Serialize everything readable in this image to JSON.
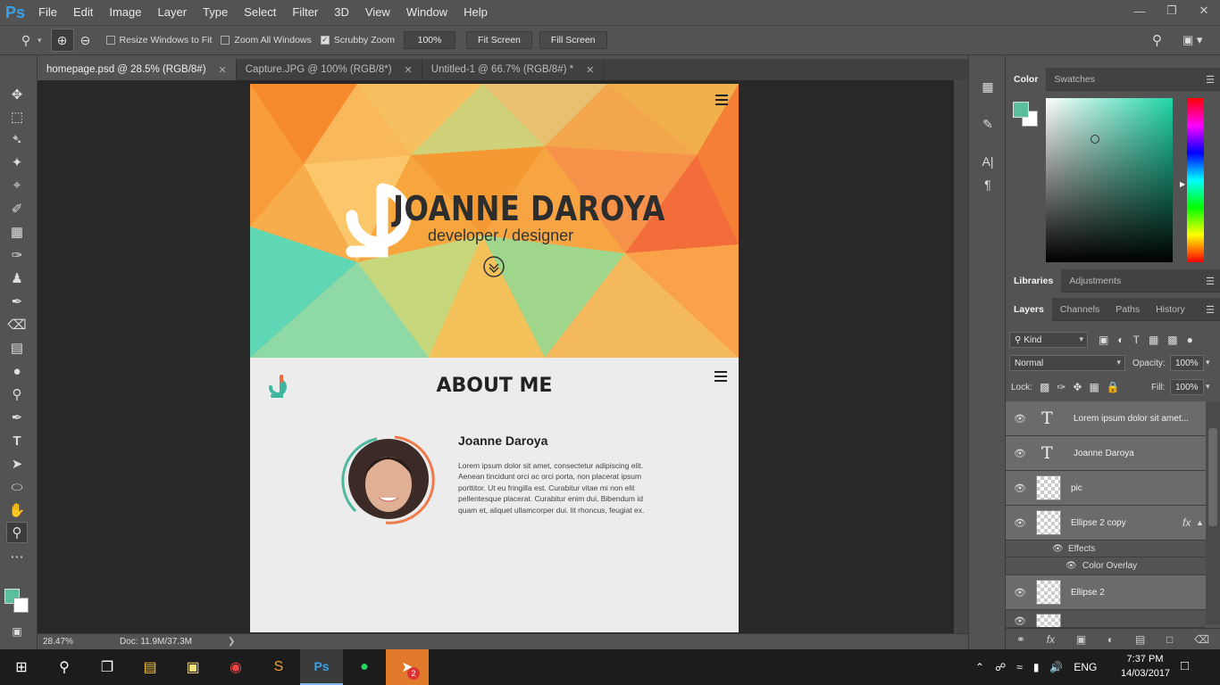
{
  "app": {
    "logo": "Ps",
    "menu": [
      "File",
      "Edit",
      "Image",
      "Layer",
      "Type",
      "Select",
      "Filter",
      "3D",
      "View",
      "Window",
      "Help"
    ],
    "window_controls": [
      "minimize-icon",
      "restore-icon",
      "close-icon"
    ]
  },
  "options": {
    "resize_windows": "Resize Windows to Fit",
    "zoom_all": "Zoom All Windows",
    "scrubby": "Scrubby Zoom",
    "zoom_value": "100%",
    "fit_screen": "Fit Screen",
    "fill_screen": "Fill Screen"
  },
  "tabs": [
    {
      "label": "homepage.psd @ 28.5% (RGB/8#)",
      "active": true
    },
    {
      "label": "Capture.JPG @ 100% (RGB/8*)",
      "active": false
    },
    {
      "label": "Untitled-1 @ 66.7% (RGB/8#) *",
      "active": false
    }
  ],
  "document": {
    "hero_name": "JOANNE DAROYA",
    "hero_sub": "developer / designer",
    "about_title": "ABOUT ME",
    "person_name": "Joanne Daroya",
    "bio": "Lorem ipsum dolor sit amet, consectetur adipiscing elit. Aenean tincidunt orci ac orci porta, non placerat ipsum porttitor. Ut eu fringilla est. Curabitur vitae mi non elit pellentesque placerat. Curabitur enim dui, Bibendum id quam et, aliquet ullamcorper dui. lit rhoncus, feugiat ex."
  },
  "status": {
    "zoom": "28.47%",
    "doc_info": "Doc: 11.9M/37.3M"
  },
  "color_panel": {
    "tabs": [
      "Color",
      "Swatches"
    ],
    "foreground": "#5bbf9f",
    "background": "#ffffff"
  },
  "libraries_panel": {
    "tabs": [
      "Libraries",
      "Adjustments"
    ]
  },
  "layers_panel": {
    "tabs": [
      "Layers",
      "Channels",
      "Paths",
      "History"
    ],
    "kind": "Kind",
    "blend_mode": "Normal",
    "opacity_label": "Opacity:",
    "opacity": "100%",
    "lock_label": "Lock:",
    "fill_label": "Fill:",
    "fill": "100%",
    "layers": [
      {
        "name": "Lorem ipsum dolor sit amet...",
        "type": "text"
      },
      {
        "name": "Joanne Daroya",
        "type": "text"
      },
      {
        "name": "pic",
        "type": "image"
      },
      {
        "name": "Ellipse 2 copy",
        "type": "shape",
        "fx": "fx"
      },
      {
        "name": "Ellipse 2",
        "type": "shape"
      }
    ],
    "effects_label": "Effects",
    "effect_item": "Color Overlay"
  },
  "taskbar": {
    "lang": "ENG",
    "time": "7:37 PM",
    "date": "14/03/2017",
    "badge": "2"
  }
}
